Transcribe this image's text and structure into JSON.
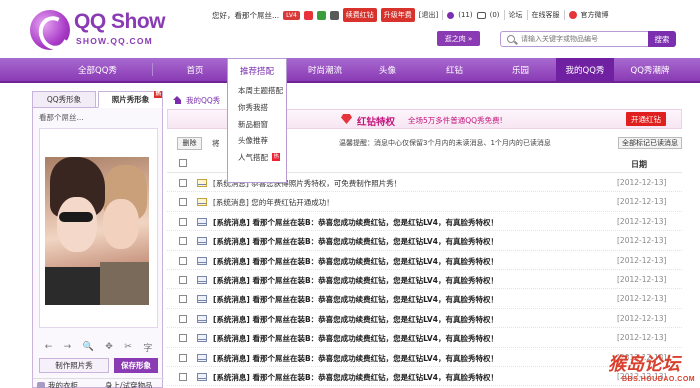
{
  "header": {
    "logo_text": "QQ Show",
    "logo_sub": "SHOW.QQ.COM",
    "greeting": "您好，看那个屌丝...",
    "vip_badge": "LV4",
    "renew_red": "续费红钻",
    "upgrade_year": "升级年费",
    "exit": "[退出]",
    "msg_count": "(11)",
    "cart_count": "(0)",
    "forum": "论坛",
    "online_service": "在线客服",
    "official": "官方微博",
    "go_button": "逛之肉 »",
    "search_placeholder": "请输入关键字或物品编号",
    "search_button": "搜索"
  },
  "nav": {
    "items": [
      "全部QQ秀",
      "首页",
      "推荐搭配",
      "时尚潮流",
      "头像",
      "红钻",
      "乐园",
      "我的QQ秀",
      "QQ秀潮牌"
    ]
  },
  "dropdown": {
    "items": [
      "本周主题搭配",
      "你秀我搭",
      "新品橱窗",
      "头像推荐",
      "人气搭配"
    ],
    "hot_label": "热"
  },
  "left_panel": {
    "tab_qq": "QQ秀形象",
    "tab_photo": "照片秀形象",
    "hot_label": "热",
    "name": "看那个屌丝...",
    "tools": [
      "←",
      "→",
      "🔍",
      "✥",
      "✂",
      "字"
    ],
    "make_photo": "制作照片秀",
    "save": "保存形象",
    "my_wardrobe": "我的衣柜",
    "try_on": "身上/试穿物品"
  },
  "main": {
    "breadcrumb": "我的QQ秀",
    "banner_title": "红钻特权",
    "banner_sub": "全场5万多件普通QQ秀免费!",
    "open_button": "开通红钻",
    "delete": "删除",
    "mark_text": "将",
    "tip": "温馨提醒：消息中心仅保留3个月内的未读消息、1个月内的已读消息",
    "all_read": "全部标记已读消息",
    "date_header": "日期",
    "messages": [
      {
        "subject": "[系统消息] 恭喜您获得照片秀特权，可免费制作照片秀！",
        "date": "[2012-12-13]",
        "bold": false
      },
      {
        "subject": "[系统消息] 您的年费红钻开通成功！",
        "date": "[2012-12-13]",
        "bold": false
      },
      {
        "subject": "[系统消息] 看那个屌丝在装B：恭喜您成功续费红钻，您是红钻LV4，有真脸秀特权！",
        "date": "[2012-12-13]",
        "bold": true
      },
      {
        "subject": "[系统消息] 看那个屌丝在装B：恭喜您成功续费红钻，您是红钻LV4，有真脸秀特权！",
        "date": "[2012-12-13]",
        "bold": true
      },
      {
        "subject": "[系统消息] 看那个屌丝在装B：恭喜您成功续费红钻，您是红钻LV4，有真脸秀特权！",
        "date": "[2012-12-13]",
        "bold": true
      },
      {
        "subject": "[系统消息] 看那个屌丝在装B：恭喜您成功续费红钻，您是红钻LV4，有真脸秀特权！",
        "date": "[2012-12-13]",
        "bold": true
      },
      {
        "subject": "[系统消息] 看那个屌丝在装B：恭喜您成功续费红钻，您是红钻LV4，有真脸秀特权！",
        "date": "[2012-12-13]",
        "bold": true
      },
      {
        "subject": "[系统消息] 看那个屌丝在装B：恭喜您成功续费红钻，您是红钻LV4，有真脸秀特权！",
        "date": "[2012-12-13]",
        "bold": true
      },
      {
        "subject": "[系统消息] 看那个屌丝在装B：恭喜您成功续费红钻，您是红钻LV4，有真脸秀特权！",
        "date": "[2012-12-13]",
        "bold": true
      },
      {
        "subject": "[系统消息] 看那个屌丝在装B：恭喜您成功续费红钻，您是红钻LV4，有真脸秀特权！",
        "date": "[2012-12-13]",
        "bold": true
      },
      {
        "subject": "[系统消息] 看那个屌丝在装B：恭喜您成功续费红钻，您是红钻LV4，有真脸秀特权！",
        "date": "[2012-12-13]",
        "bold": true
      }
    ]
  },
  "watermark": {
    "logo": "猴岛论坛",
    "url": "BBS.HOUDAO.COM"
  }
}
